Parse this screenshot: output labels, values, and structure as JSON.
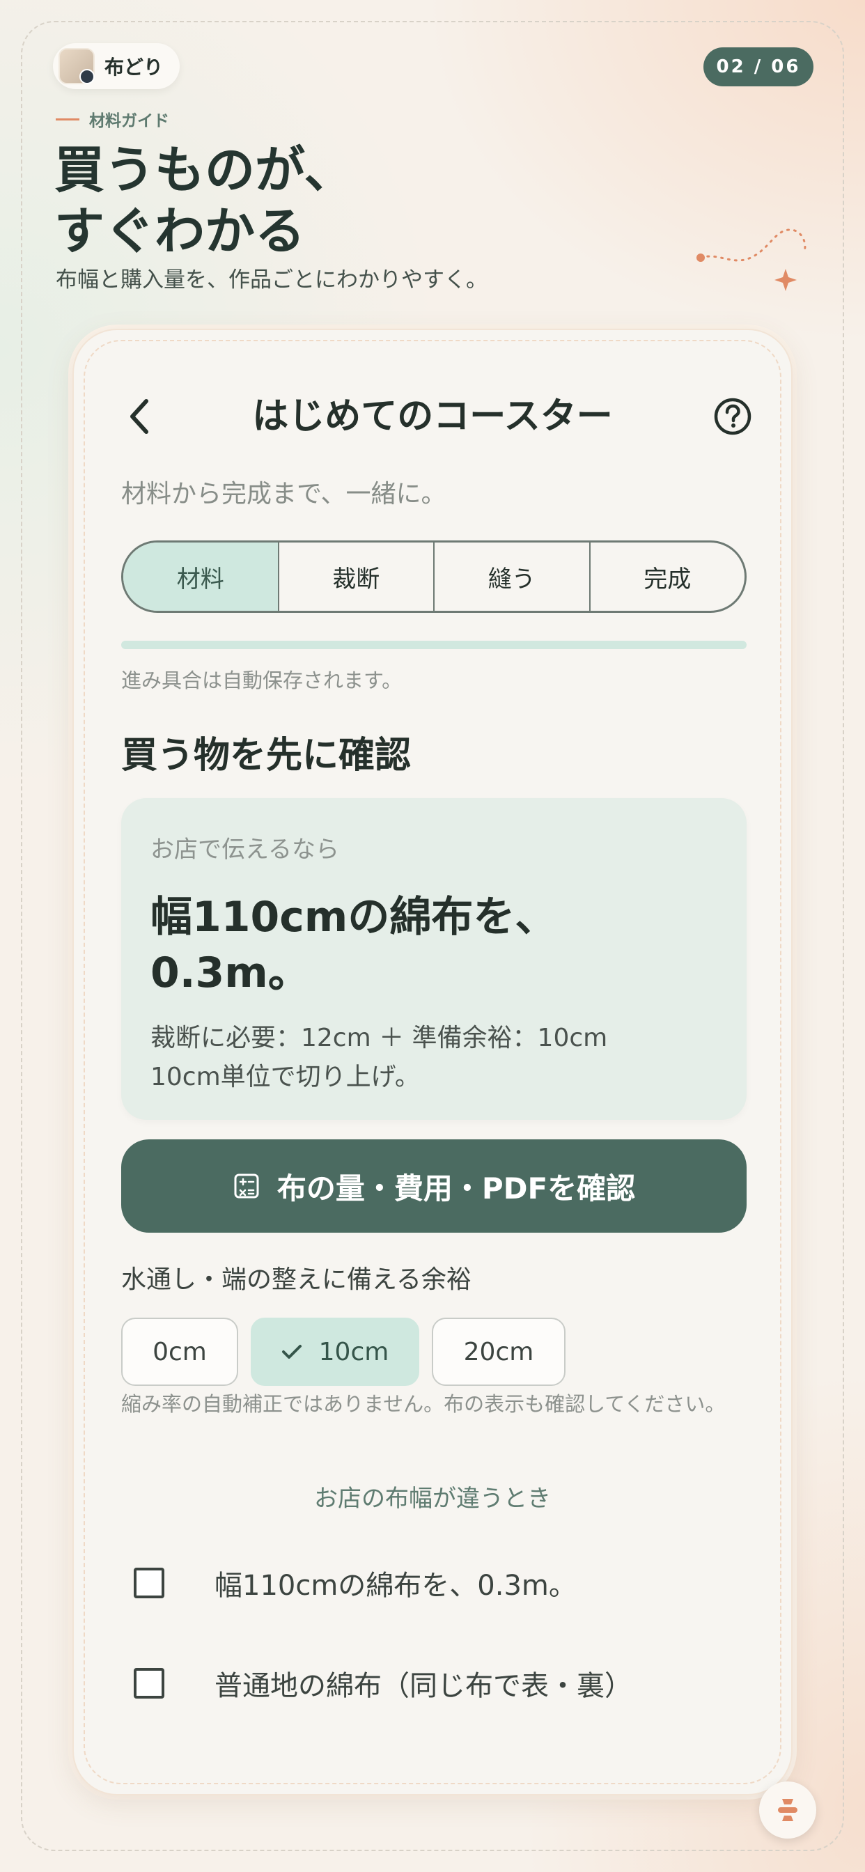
{
  "brand": {
    "name": "布どり",
    "avatar_icon": "fabric-thumbnail-icon"
  },
  "page_counter": "02 / 06",
  "hero": {
    "eyebrow": "材料ガイド",
    "headline": "買うものが、\nすぐわかる",
    "lead": "布幅と購入量を、作品ごとにわかりやすく。"
  },
  "app": {
    "title": "はじめてのコースター",
    "subtitle": "材料から完成まで、一緒に。",
    "tabs": [
      {
        "label": "材料",
        "active": true
      },
      {
        "label": "裁断",
        "active": false
      },
      {
        "label": "縫う",
        "active": false
      },
      {
        "label": "完成",
        "active": false
      }
    ],
    "progress_fraction": 1.0,
    "autosave_note": "進み具合は自動保存されます。",
    "section_title": "買う物を先に確認",
    "info": {
      "kicker": "お店で伝えるなら",
      "main": "幅110cmの綿布を、\n0.3m。",
      "detail": "裁断に必要：12cm ＋ 準備余裕：10cm\n10cm単位で切り上げ。"
    },
    "cta_label": "布の量・費用・PDFを確認",
    "allowance_label": "水通し・端の整えに備える余裕",
    "allowance_options": [
      {
        "label": "0cm",
        "selected": false
      },
      {
        "label": "10cm",
        "selected": true
      },
      {
        "label": "20cm",
        "selected": false
      }
    ],
    "allowance_note": "縮み率の自動補正ではありません。布の表示も確認してください。",
    "width_link": "お店の布幅が違うとき",
    "checklist": [
      {
        "label": "幅110cmの綿布を、0.3m。",
        "checked": false
      },
      {
        "label": "普通地の綿布（同じ布で表・裏）",
        "checked": false
      }
    ]
  },
  "colors": {
    "accent": "#4b6b61",
    "accent_soft": "#cfe8df",
    "orange": "#e08a64",
    "text": "#25302b"
  }
}
